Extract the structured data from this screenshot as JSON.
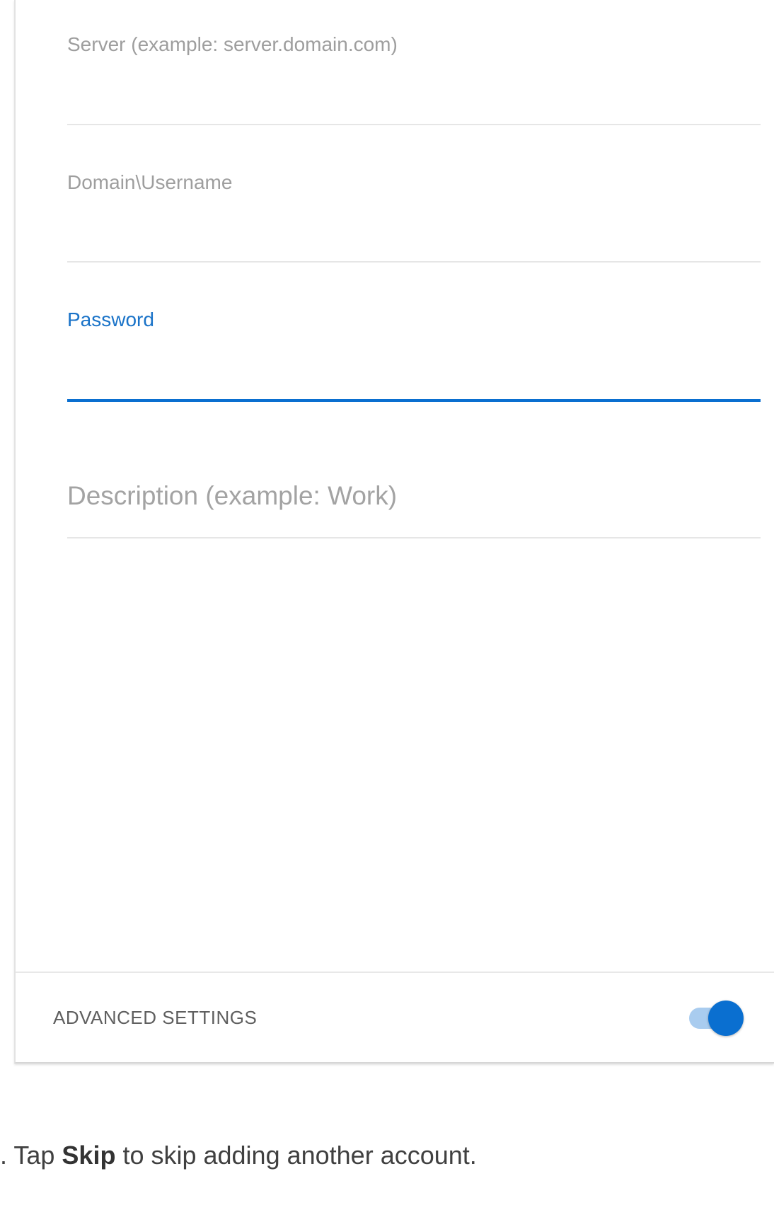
{
  "form": {
    "server_label": "Server (example: server.domain.com)",
    "username_label": "Domain\\Username",
    "password_label": "Password",
    "description_placeholder": "Description (example: Work)",
    "advanced_settings_label": "ADVANCED SETTINGS",
    "advanced_settings_enabled": true
  },
  "instruction": {
    "prefix": ". Tap ",
    "bold": "Skip",
    "suffix": " to skip adding another account."
  },
  "colors": {
    "accent": "#0a6fd0",
    "toggle_track": "#a9ccef",
    "label_gray": "#9e9e9e"
  }
}
